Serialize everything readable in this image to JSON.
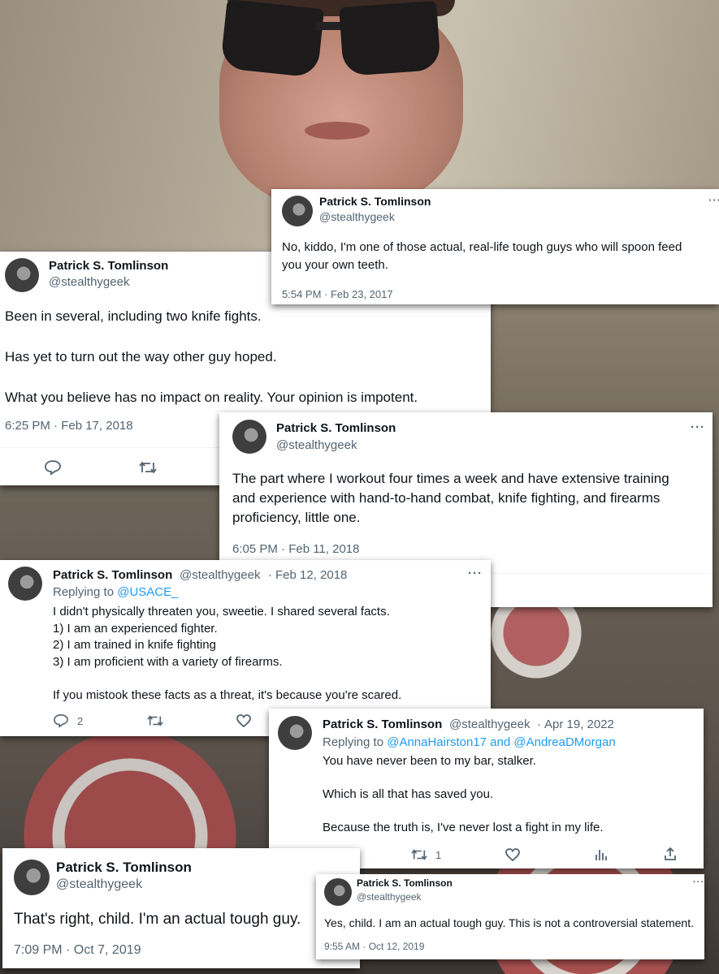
{
  "author": {
    "name": "Patrick S. Tomlinson",
    "handle": "@stealthygeek"
  },
  "tweets": [
    {
      "text": [
        "No, kiddo, I'm one of those actual, real-life tough guys who will spoon feed",
        "you your own teeth."
      ],
      "time": "5:54 PM · Feb 23, 2017"
    },
    {
      "text": [
        "Been in several, including two knife fights.",
        "Has yet to turn out the way other guy hoped.",
        "What you believe has no impact on reality. Your opinion is impotent."
      ],
      "time": "6:25 PM · Feb 17, 2018"
    },
    {
      "text": [
        "The part where I workout four times a week and have extensive training",
        "and experience with hand-to-hand combat, knife fighting, and firearms",
        "proficiency, little one."
      ],
      "time": "6:05 PM · Feb 11, 2018"
    },
    {
      "date": "Feb 12, 2018",
      "replying_label": "Replying to",
      "replying_to": "@USACE_",
      "text": [
        "I didn't physically threaten you, sweetie. I shared several facts.",
        "1) I am an experienced fighter.",
        "2) I am trained in knife fighting",
        "3) I am proficient with a variety of firearms.",
        "If you mistook these facts as a threat, it's because you're scared."
      ],
      "reply_count": "2"
    },
    {
      "date": "Apr 19, 2022",
      "replying_label": "Replying to",
      "replying_to": "@AnnaHairston17 and @AndreaDMorgan",
      "text": [
        "You have never been to my bar, stalker.",
        "Which is all that has saved you.",
        "Because the truth is, I've never lost a fight in my life."
      ],
      "retweet_count": "1"
    },
    {
      "text": [
        "That's right, child. I'm an actual tough guy."
      ],
      "time": "7:09 PM · Oct 7, 2019"
    },
    {
      "text": [
        "Yes, child. I am an actual tough guy. This is not a controversial statement."
      ],
      "time": "9:55 AM · Oct 12, 2019"
    }
  ],
  "icons": {
    "more": "···",
    "reply": "reply-icon",
    "retweet": "retweet-icon",
    "like": "like-icon",
    "views": "views-icon",
    "share": "share-icon"
  },
  "colors": {
    "link": "#1d9bf0",
    "muted": "#536471",
    "text": "#0f1419"
  }
}
